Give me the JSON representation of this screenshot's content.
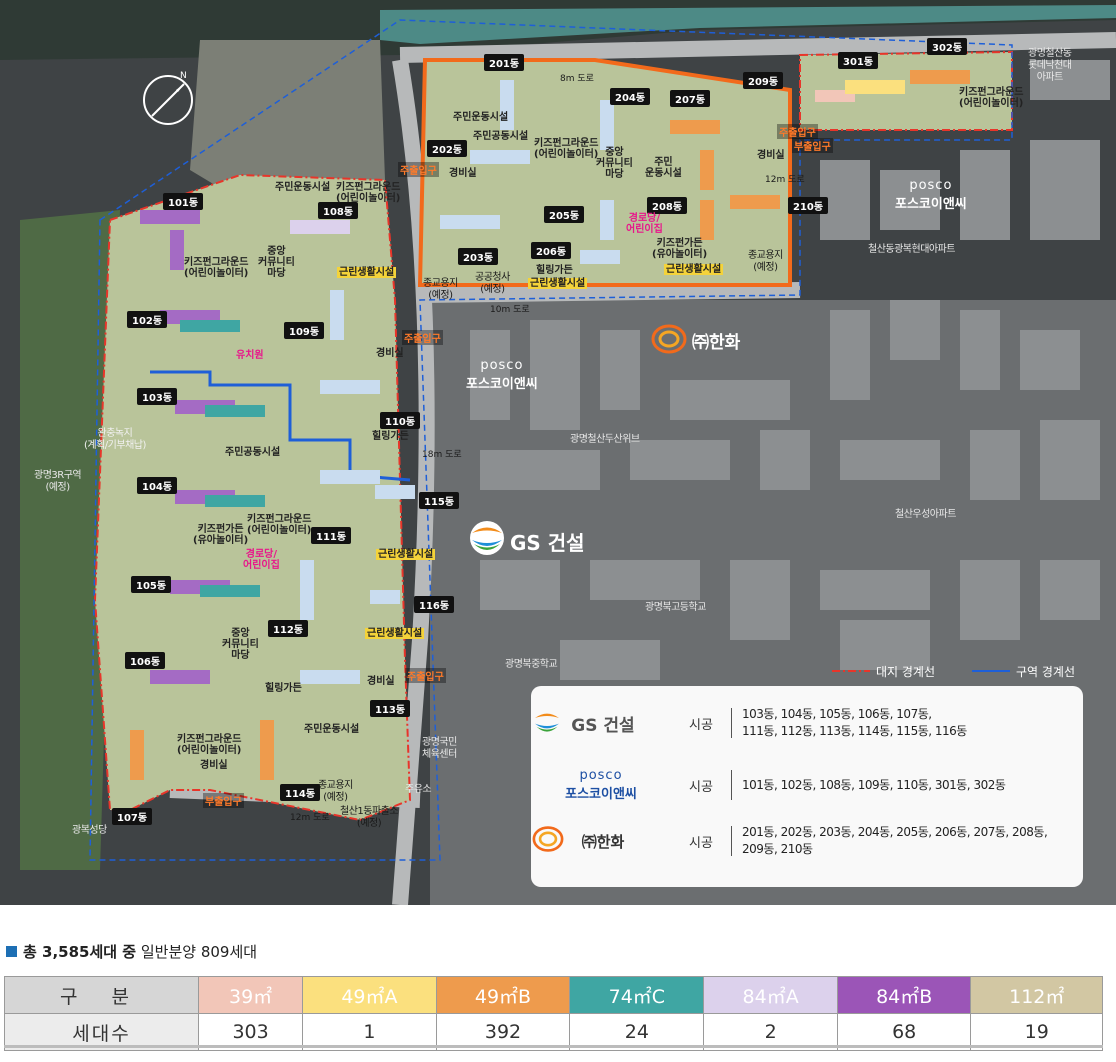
{
  "map": {
    "road_labels": [
      "8m 도로",
      "12m 도로",
      "10m 도로",
      "18m 도로",
      "12m 도로"
    ],
    "place_labels": {
      "ne_apartment": "광명철산동\n롯데낙천대\n아파트",
      "north_apartment": "철산동광복현대아파트",
      "doosan": "광명철산두산위브",
      "woosung": "철산우성아파트",
      "high_school": "광명북고등학교",
      "middle_school": "광명북중학교",
      "sports": "광명국민\n체육센터",
      "gas": "주유소",
      "seongdang": "광복성당",
      "zone": "광명3R구역\n(예정)",
      "green": "완충녹지\n(계획/기부채납)",
      "religion_1": "종교용지\n(예정)",
      "office": "공공청사\n(예정)",
      "religion_2": "종교용지\n(예정)",
      "religion_3": "종교용지\n(예정)",
      "police": "철산1동파출소\n(예정)"
    },
    "gates": [
      "주출입구",
      "주출입구",
      "주출입구",
      "주출입구",
      "부출입구",
      "부출입구"
    ],
    "buildings": [
      "101동",
      "102동",
      "103동",
      "104동",
      "105동",
      "106동",
      "107동",
      "108동",
      "109동",
      "110동",
      "111동",
      "112동",
      "113동",
      "114동",
      "115동",
      "116동",
      "201동",
      "202동",
      "203동",
      "204동",
      "205동",
      "206동",
      "207동",
      "208동",
      "209동",
      "210동",
      "301동",
      "302동"
    ],
    "facilities": {
      "f1": "주민운동시설",
      "f2": "키즈펀그라운드\n(어린이놀이터)",
      "f3": "중앙\n커뮤니티\n마당",
      "f4": "키즈펀그라운드\n(어린이놀이터)",
      "f5": "근린생활시설",
      "f6": "유치원",
      "f7": "경비실",
      "f8": "힐링가든",
      "f9": "주민공동시설",
      "f10": "키즈펀가든\n(유아놀이터)",
      "f11": "키즈펀그라운드\n(어린이놀이터)",
      "f12": "경로당/\n어린이집",
      "f13": "근린생활시설",
      "f14": "중앙\n커뮤니티\n마당",
      "f15": "근린생활시설",
      "f16": "힐링가든",
      "f17": "주민운동시설",
      "f18": "키즈펀그라운드\n(어린이놀이터)",
      "f19": "경비실",
      "f20": "경비실",
      "f21": "주민운동시설",
      "f22": "주민공동시설",
      "f23": "키즈펀그라운드\n(어린이놀이터)",
      "f24": "중앙\n커뮤니티\n마당",
      "f25": "주민\n운동시설",
      "f26": "경로당/\n어린이집",
      "f27": "키즈펀가든\n(유아놀이터)",
      "f28": "힐링가든",
      "f29": "근린생활시설",
      "f30": "근린생활시설",
      "f31": "경비실",
      "f32": "경비실",
      "f33": "키즈펀그라운드\n(어린이놀이터)"
    },
    "brand_posco_en": "posco",
    "brand_posco_ko": "포스코이앤씨",
    "brand_hanwha": "㈜한화",
    "brand_gs": "GS 건설",
    "legend": {
      "site_boundary": "대지 경계선",
      "zone_boundary": "구역 경계선"
    },
    "colors": {
      "site_boundary": "#e8352a",
      "zone_boundary": "#1e5fd8",
      "orange_boundary": "#f26a1b"
    }
  },
  "builders": [
    {
      "brand": "GS 건설",
      "work": "시공",
      "buildings": "103동, 104동, 105동, 106동, 107동,\n111동, 112동, 113동, 114동, 115동, 116동"
    },
    {
      "brand_en": "posco",
      "brand_ko": "포스코이앤씨",
      "work": "시공",
      "buildings": "101동, 102동, 108동, 109동, 110동, 301동, 302동"
    },
    {
      "brand": "㈜한화",
      "work": "시공",
      "buildings": "201동, 202동, 203동, 204동, 205동, 206동, 207동, 208동,\n209동, 210동"
    }
  ],
  "summary": {
    "prefix": "총 3,585세대 중",
    "suffix": "일반분양 809세대"
  },
  "unit_table": {
    "row_label_type": "구 분",
    "row_label_count": "세대수",
    "types": [
      "39㎡",
      "49㎡A",
      "49㎡B",
      "74㎡C",
      "84㎡A",
      "84㎡B",
      "112㎡"
    ],
    "counts": [
      "303",
      "1",
      "392",
      "24",
      "2",
      "68",
      "19"
    ],
    "colors": [
      "#f2c6b8",
      "#fbe07e",
      "#ee9b4d",
      "#3fa6a3",
      "#dcd1ec",
      "#9b55b7",
      "#d2c7a3"
    ]
  }
}
